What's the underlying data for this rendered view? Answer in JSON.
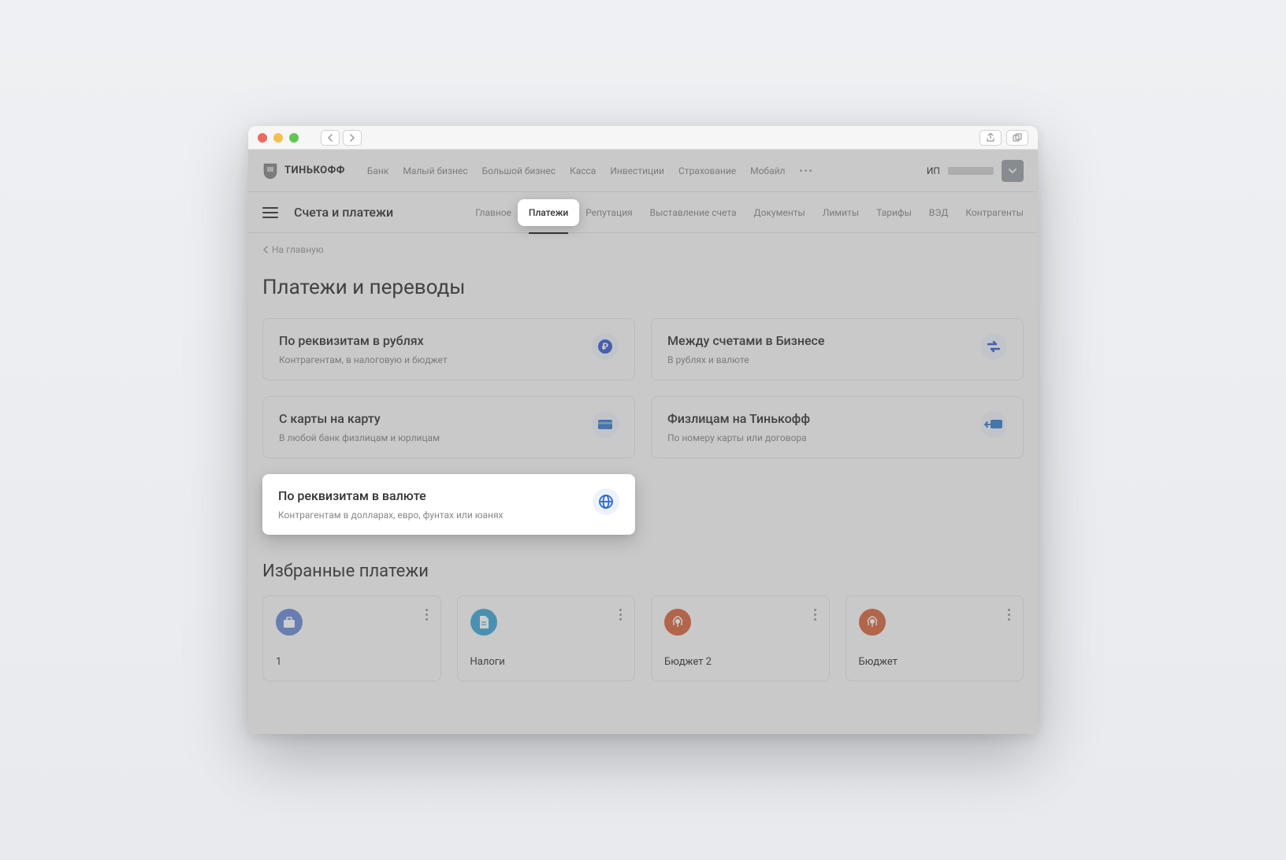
{
  "brand": "ТИНЬКОФФ",
  "top_nav": {
    "links": [
      "Банк",
      "Малый бизнес",
      "Большой бизнес",
      "Касса",
      "Инвестиции",
      "Страхование",
      "Мобайл"
    ]
  },
  "user": {
    "prefix": "ИП"
  },
  "section_title": "Счета и платежи",
  "sub_tabs": [
    "Главное",
    "Платежи",
    "Репутация",
    "Выставление счета",
    "Документы",
    "Лимиты",
    "Тарифы",
    "ВЭД",
    "Контрагенты"
  ],
  "active_tab_index": 1,
  "breadcrumb": "На главную",
  "page_heading": "Платежи и переводы",
  "cards": [
    {
      "title": "По реквизитам в рублях",
      "desc": "Контрагентам, в налоговую и бюджет",
      "icon": "ruble-icon",
      "color": "#3c5ecc"
    },
    {
      "title": "Между счетами в Бизнесе",
      "desc": "В рублях и валюте",
      "icon": "swap-icon",
      "color": "#3c5ecc"
    },
    {
      "title": "С карты на карту",
      "desc": "В любой банк физлицам и юрлицам",
      "icon": "card-icon",
      "color": "#3c7ecc"
    },
    {
      "title": "Физлицам на Тинькофф",
      "desc": "По номеру карты или договора",
      "icon": "receive-card-icon",
      "color": "#3c7ecc"
    },
    {
      "title": "По реквизитам в валюте",
      "desc": "Контрагентам в долларах, евро, фунтах или юанях",
      "icon": "globe-icon",
      "color": "#2d66d8",
      "highlighted": true
    }
  ],
  "favorites_heading": "Избранные платежи",
  "favorites": [
    {
      "label": "1",
      "icon": "briefcase-icon",
      "bg": "#6b8bd6"
    },
    {
      "label": "Налоги",
      "icon": "doc-icon",
      "bg": "#3ea7d6"
    },
    {
      "label": "Бюджет 2",
      "icon": "emblem-icon",
      "bg": "#d6663e"
    },
    {
      "label": "Бюджет",
      "icon": "emblem-icon",
      "bg": "#d6663e"
    }
  ]
}
